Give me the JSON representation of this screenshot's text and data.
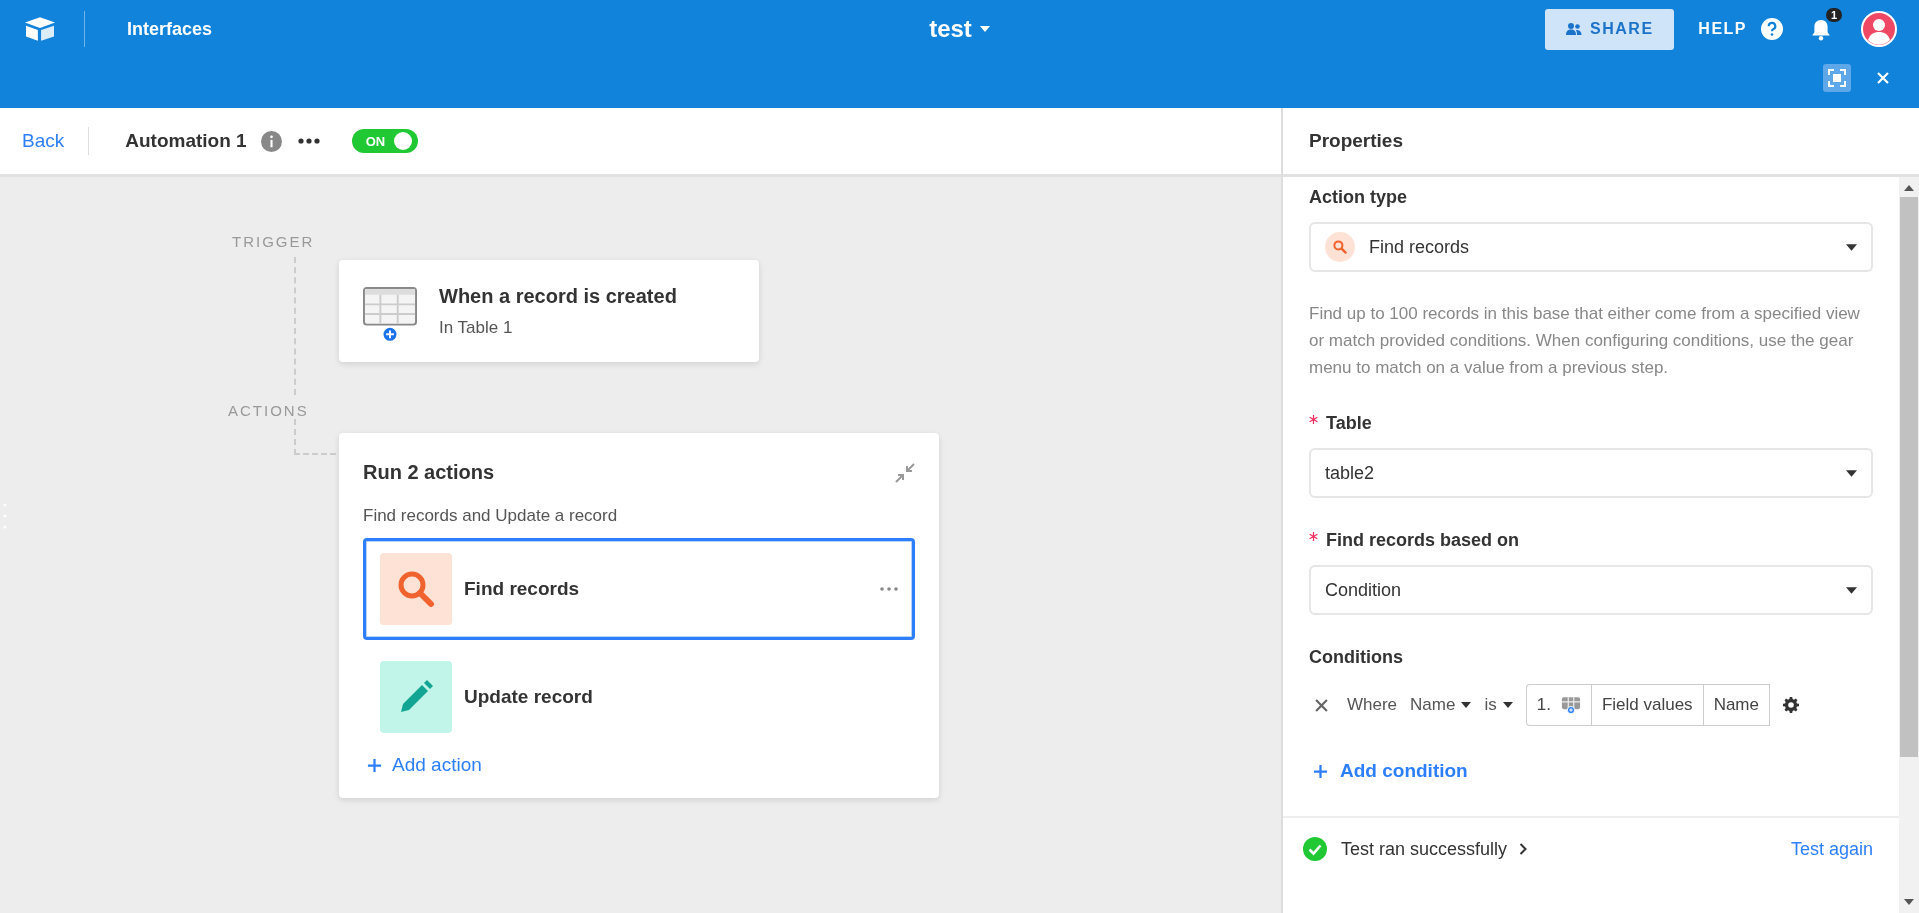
{
  "topbar": {
    "section": "Interfaces",
    "base_title": "test",
    "share_button": "SHARE",
    "help_link": "HELP",
    "notification_count": "1"
  },
  "automation_bar": {
    "back_link": "Back",
    "name": "Automation 1",
    "toggle": {
      "label": "ON",
      "on": true
    }
  },
  "flow": {
    "trigger_label": "TRIGGER",
    "trigger": {
      "title": "When a record is created",
      "subtitle": "In Table 1"
    },
    "actions_label": "ACTIONS",
    "actions_group": {
      "title": "Run 2 actions",
      "summary": "Find records and Update a record",
      "actions": [
        {
          "kind": "find",
          "label": "Find records",
          "selected": true
        },
        {
          "kind": "update",
          "label": "Update record",
          "selected": false
        }
      ],
      "add_action": "Add action"
    }
  },
  "properties": {
    "title": "Properties",
    "action_type_label": "Action type",
    "action_type": {
      "kind": "find",
      "value": "Find records"
    },
    "description": "Find up to 100 records in this base that either come from a specified view or match provided conditions. When configuring conditions, use the gear menu to match on a value from a previous step.",
    "fields": [
      {
        "label": "Table",
        "required": true,
        "value": "table2"
      },
      {
        "label": "Find records based on",
        "required": true,
        "value": "Condition"
      }
    ],
    "conditions_label": "Conditions",
    "conditions": [
      {
        "where": "Where",
        "field": "Name",
        "operator": "is",
        "step": "1.",
        "value_parts": [
          "Field values",
          "Name"
        ]
      }
    ],
    "add_condition": "Add condition",
    "test": {
      "status": "Test ran successfully",
      "success": true,
      "retry_link": "Test again"
    }
  }
}
